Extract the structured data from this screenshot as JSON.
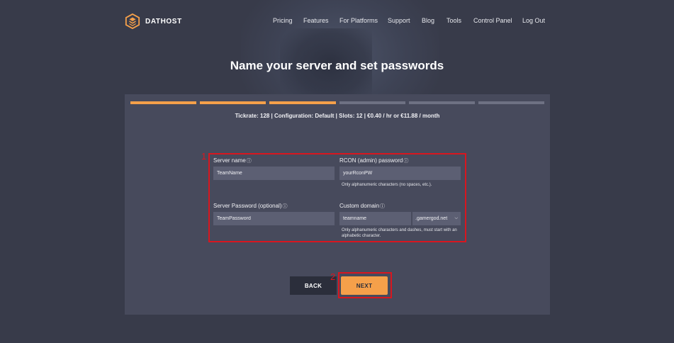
{
  "header": {
    "brand": "DATHOST",
    "nav": [
      {
        "label": "Pricing"
      },
      {
        "label": "Features"
      },
      {
        "label": "For Platforms"
      },
      {
        "label": "Support"
      },
      {
        "label": "Blog"
      },
      {
        "label": "Tools"
      },
      {
        "label": "Control Panel"
      },
      {
        "label": "Log Out"
      }
    ]
  },
  "page": {
    "title": "Name your server and set passwords"
  },
  "steps": {
    "total": 6,
    "completed": 3
  },
  "summary": "Tickrate: 128 | Configuration: Default | Slots: 12 | €0.40 / hr or €11.88 / month",
  "form": {
    "server_name": {
      "label": "Server name",
      "info_icon": "ⓘ",
      "value": "TeamName"
    },
    "rcon_password": {
      "label": "RCON (admin) password",
      "info_icon": "ⓘ",
      "value": "yourRconPW",
      "hint": "Only alphanumeric characters (no spaces, etc.)."
    },
    "server_password": {
      "label": "Server Password (optional)",
      "info_icon": "ⓘ",
      "value": "TeamPassword"
    },
    "custom_domain": {
      "label": "Custom domain",
      "info_icon": "ⓘ",
      "value": "teamname",
      "domain_selected": ".gamergod.net",
      "hint": "Only alphanumeric characters and dashes, must start with an alphabetic character."
    }
  },
  "buttons": {
    "back": "BACK",
    "next": "NEXT"
  },
  "annotations": {
    "one": "1",
    "two": "2",
    "color": "#d8161f"
  },
  "colors": {
    "accent": "#f5a04a",
    "background": "#383b4a",
    "card": "#474a5c"
  }
}
